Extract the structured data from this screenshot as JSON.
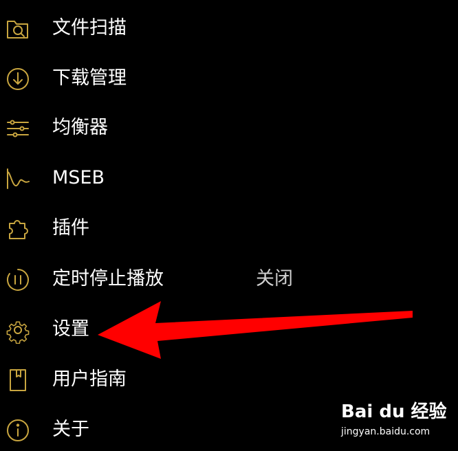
{
  "theme": {
    "background": "#000000",
    "icon_color": "#c9a640",
    "text_color": "#ffffff",
    "arrow_color": "#ff0000"
  },
  "menu": {
    "items": [
      {
        "label": "文件扫描",
        "icon": "folder-scan-icon"
      },
      {
        "label": "下载管理",
        "icon": "download-icon"
      },
      {
        "label": "均衡器",
        "icon": "equalizer-icon"
      },
      {
        "label": "MSEB",
        "icon": "waveform-icon"
      },
      {
        "label": "插件",
        "icon": "puzzle-icon"
      },
      {
        "label": "定时停止播放",
        "icon": "timer-pause-icon",
        "value": "关闭"
      },
      {
        "label": "设置",
        "icon": "gear-icon"
      },
      {
        "label": "用户指南",
        "icon": "book-icon"
      },
      {
        "label": "关于",
        "icon": "info-icon"
      }
    ]
  },
  "watermark": {
    "logo": "Bai du 经验",
    "url": "jingyan.baidu.com"
  }
}
